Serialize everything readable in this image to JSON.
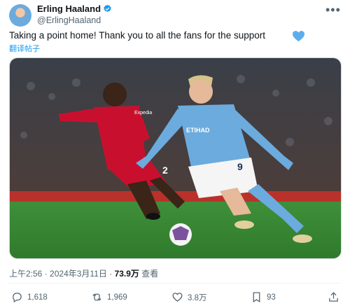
{
  "author": {
    "name": "Erling Haaland",
    "handle": "@ErlingHaaland"
  },
  "tweet": {
    "text": "Taking a point home! Thank you to all the fans for the support",
    "translate": "翻译帖子"
  },
  "meta": {
    "time": "上午2:56",
    "date": "2024年3月11日",
    "views": "73.9万",
    "views_label": "查看",
    "sep": "·"
  },
  "actions": {
    "replies": "1,618",
    "reposts": "1,969",
    "likes": "3.8万",
    "bookmarks": "93"
  },
  "colors": {
    "accent": "#1d9bf0",
    "text": "#0f1419",
    "secondary": "#536471"
  },
  "icons": [
    "verified-badge-icon",
    "more-icon",
    "blue-heart-icon",
    "reply-icon",
    "repost-icon",
    "like-icon",
    "bookmark-icon",
    "share-icon"
  ],
  "image": {
    "description_hidden": true,
    "jersey_number": "9",
    "jersey_number_red": "2",
    "sponsor_city": "ETIHAD",
    "sponsor_red": "Expedia"
  }
}
